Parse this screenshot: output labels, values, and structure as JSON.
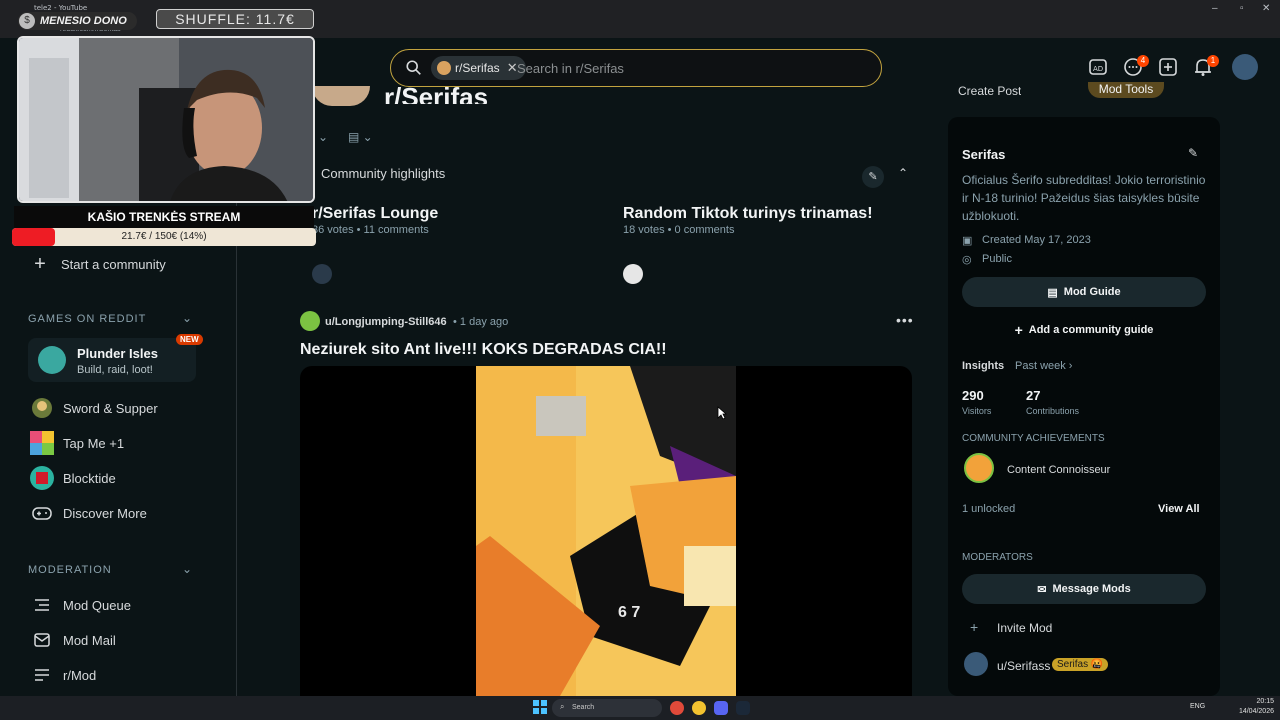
{
  "browser": {
    "tab1": "tele2 - YouTube",
    "url": "reddit.com/r/Serifas"
  },
  "search": {
    "chip_label": "r/Serifas",
    "placeholder": "Search in r/Serifas"
  },
  "header": {
    "chat_badge": "4",
    "notif_badge": "1"
  },
  "subreddit": {
    "name": "r/Serifas",
    "create_post": "Create Post",
    "mod_tools": "Mod Tools"
  },
  "sidebar": {
    "start_community": "Start a community",
    "games_title": "GAMES ON REDDIT",
    "games": [
      {
        "name": "Plunder Isles",
        "sub": "Build, raid, loot!",
        "badge": "NEW"
      },
      {
        "name": "Sword & Supper"
      },
      {
        "name": "Tap Me +1"
      },
      {
        "name": "Blocktide"
      },
      {
        "name": "Discover More"
      }
    ],
    "moderation_title": "MODERATION",
    "moderation": [
      {
        "name": "Mod Queue"
      },
      {
        "name": "Mod Mail"
      },
      {
        "name": "r/Mod"
      }
    ]
  },
  "highlights": {
    "title": "Community highlights",
    "cards": [
      {
        "title": "r/Serifas Lounge",
        "meta": "36 votes • 11 comments"
      },
      {
        "title": "Random Tiktok turinys trinamas!",
        "meta": "18 votes • 0 comments"
      }
    ]
  },
  "post": {
    "author": "u/Longjumping-Still646",
    "time": "• 1 day ago",
    "title": "Neziurek sito Ant live!!! KOKS DEGRADAS CIA!!",
    "video_overlay": "6 7"
  },
  "about": {
    "title": "Serifas",
    "description": "Oficialus Šerifo subredditas! Jokio terroristinio ir N-18 turinio! Pažeidus šias taisykles būsite užblokuoti.",
    "created": "Created May 17, 2023",
    "visibility": "Public",
    "mod_guide": "Mod Guide",
    "add_guide": "Add a community guide",
    "insights": "Insights",
    "insights_range": "Past week",
    "visitors_value": "290",
    "visitors_label": "Visitors",
    "contrib_value": "27",
    "contrib_label": "Contributions",
    "achievements_title": "COMMUNITY ACHIEVEMENTS",
    "achievement": "Content Connoisseur",
    "unlocked": "1 unlocked",
    "view_all": "View All",
    "moderators_title": "MODERATORS",
    "message_mods": "Message Mods",
    "invite_mod": "Invite Mod",
    "mod_user": "u/Serifass",
    "mod_flair": "Serifas 🤬"
  },
  "stream": {
    "dono": "MENESIO DONO",
    "shuffle": "SHUFFLE: 11.7€",
    "title": "KAŠIO TRENKĖS STREAM",
    "goal": "21.7€ / 150€ (14%)",
    "goal_progress": 0.14
  },
  "taskbar": {
    "search": "Search",
    "lang": "ENG",
    "time": "20:15",
    "date": "14/04/2026"
  },
  "colors": {
    "accent": "#ff4500",
    "search_border": "#c2a33f",
    "background": "#0b1416"
  }
}
